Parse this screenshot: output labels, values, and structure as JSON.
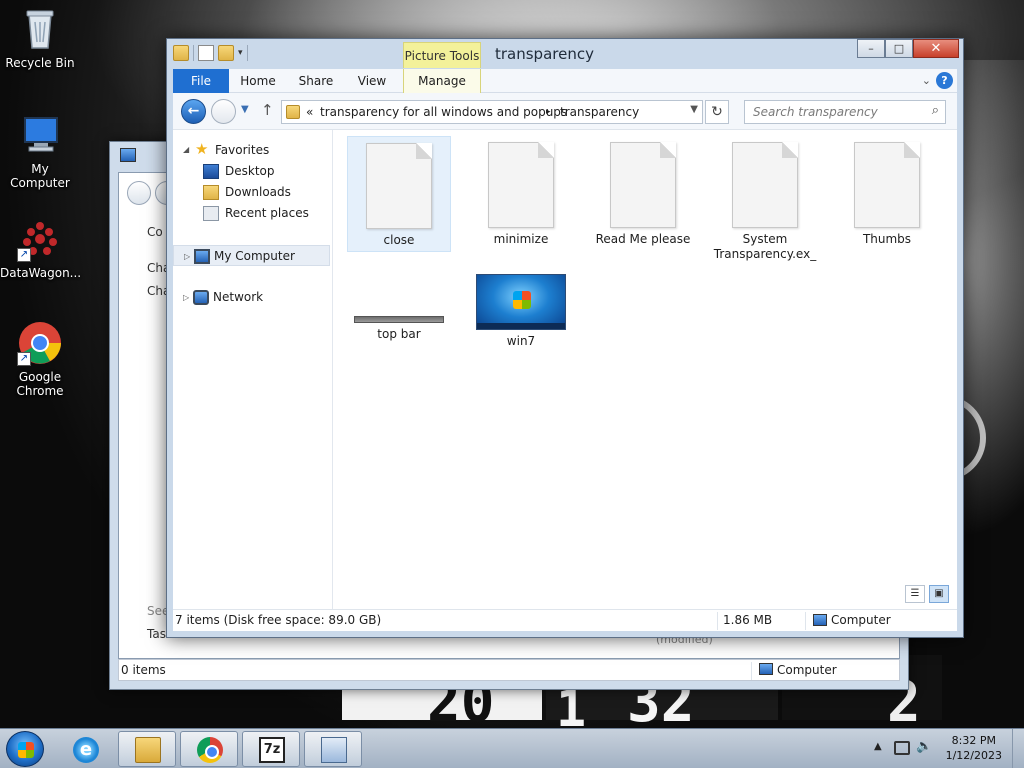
{
  "desktop": {
    "icons": [
      {
        "label": "Recycle Bin",
        "icon": "recycle-bin-icon"
      },
      {
        "label": "My Computer",
        "icon": "computer-icon"
      },
      {
        "label": "DataWagon...",
        "icon": "datawagon-icon"
      },
      {
        "label": "Google Chrome",
        "icon": "chrome-icon"
      }
    ],
    "clock_digits": [
      "20",
      "1",
      "32",
      "2"
    ]
  },
  "background_window": {
    "text_lines": [
      "Co",
      "Cha",
      "Cha",
      "See",
      "Tas",
      "(modified)"
    ],
    "status": {
      "items": "0 items",
      "location": "Computer"
    }
  },
  "window": {
    "title": "transparency",
    "contextual_tab": "Picture Tools",
    "caption": {
      "minimize": "–",
      "maximize": "□",
      "close": "✕"
    },
    "ribbon_tabs": [
      "File",
      "Home",
      "Share",
      "View",
      "Manage"
    ],
    "address": {
      "chevron": "«",
      "crumbs": [
        "transparency for all windows and popups",
        "transparency"
      ],
      "separator": "▸"
    },
    "search": {
      "placeholder": "Search transparency"
    },
    "nav": {
      "favorites": "Favorites",
      "favorite_items": [
        "Desktop",
        "Downloads",
        "Recent places"
      ],
      "computer": "My Computer",
      "network": "Network"
    },
    "files": [
      {
        "name": "close",
        "kind": "document",
        "selected": true
      },
      {
        "name": "minimize",
        "kind": "document"
      },
      {
        "name": "Read Me please",
        "kind": "document"
      },
      {
        "name": "System Transparency.ex_",
        "kind": "document"
      },
      {
        "name": "Thumbs",
        "kind": "document"
      },
      {
        "name": "top bar",
        "kind": "image-bar"
      },
      {
        "name": "win7",
        "kind": "image-win7"
      }
    ],
    "status": {
      "summary": "7 items (Disk free space: 89.0 GB)",
      "size": "1.86 MB",
      "location": "Computer"
    }
  },
  "taskbar": {
    "apps": [
      "internet-explorer",
      "file-explorer",
      "google-chrome",
      "7-zip",
      "control-panel"
    ],
    "seven_zip_label": "7z",
    "ie_letter": "e",
    "time": "8:32 PM",
    "date": "1/12/2023"
  }
}
